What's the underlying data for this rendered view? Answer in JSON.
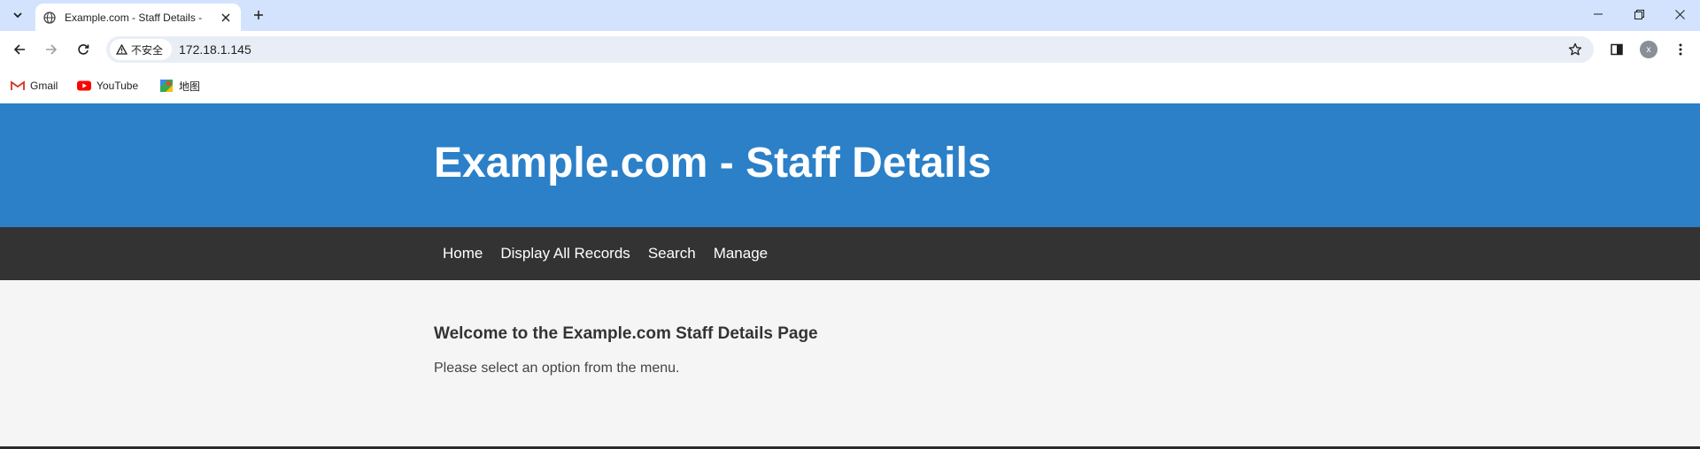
{
  "browser": {
    "tab": {
      "title": "Example.com - Staff Details - ",
      "favicon": "globe-icon"
    },
    "address_bar": {
      "security_label": "不安全",
      "url": "172.18.1.145"
    },
    "profile_initial": "x",
    "bookmarks": [
      {
        "label": "Gmail",
        "icon": "gmail-icon"
      },
      {
        "label": "YouTube",
        "icon": "youtube-icon"
      },
      {
        "label": "地图",
        "icon": "maps-icon"
      }
    ]
  },
  "site": {
    "title": "Example.com - Staff Details",
    "nav": [
      {
        "label": "Home"
      },
      {
        "label": "Display All Records"
      },
      {
        "label": "Search"
      },
      {
        "label": "Manage"
      }
    ],
    "welcome_heading": "Welcome to the Example.com Staff Details Page",
    "instructions": "Please select an option from the menu."
  },
  "colors": {
    "header_bg": "#2b80c8",
    "nav_bg": "#333333",
    "content_bg": "#f5f5f5",
    "tabstrip_bg": "#d3e3fd"
  }
}
